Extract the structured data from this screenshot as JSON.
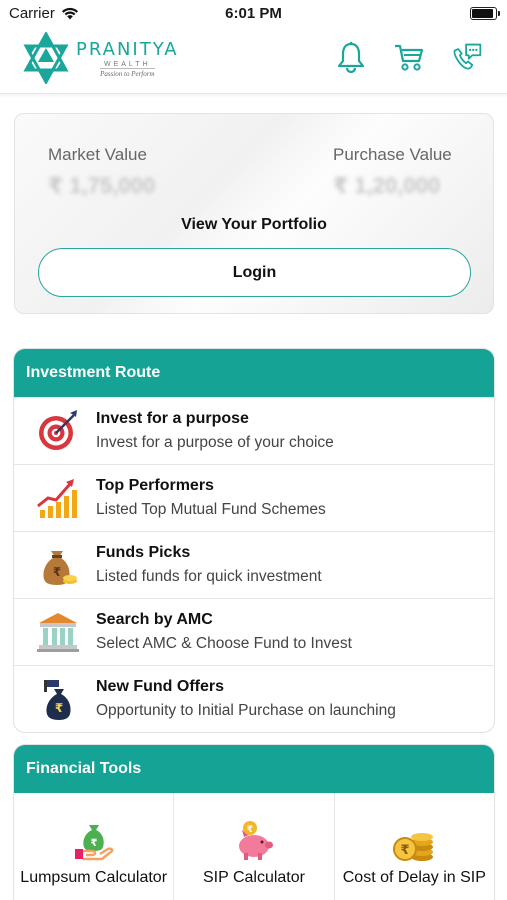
{
  "status": {
    "carrier": "Carrier",
    "time": "6:01 PM",
    "battery_level": 0.9
  },
  "header": {
    "brand": "PRANITYA",
    "brand_sub": "WEALTH",
    "tagline": "Passion to Perform",
    "icons": [
      "bell-icon",
      "cart-icon",
      "chat-phone-icon"
    ],
    "accent": "#14a394"
  },
  "portfolio": {
    "market_label": "Market Value",
    "market_value": "₹ 1,75,000",
    "purchase_label": "Purchase Value",
    "purchase_value": "₹ 1,20,000",
    "title": "View Your Portfolio",
    "login_label": "Login"
  },
  "investment_route": {
    "title": "Investment Route",
    "items": [
      {
        "title": "Invest for a purpose",
        "desc": "Invest for a purpose of your choice",
        "icon": "target-icon"
      },
      {
        "title": "Top Performers",
        "desc": "Listed Top Mutual Fund Schemes",
        "icon": "growth-chart-icon"
      },
      {
        "title": "Funds Picks",
        "desc": "Listed funds for quick investment",
        "icon": "money-bag-icon"
      },
      {
        "title": "Search by AMC",
        "desc": "Select AMC & Choose Fund to Invest",
        "icon": "bank-icon"
      },
      {
        "title": "New Fund Offers",
        "desc": "Opportunity to Initial Purchase on launching",
        "icon": "nfo-bag-icon"
      }
    ]
  },
  "financial_tools": {
    "title": "Financial Tools",
    "items": [
      {
        "label": "Lumpsum Calculator",
        "icon": "lumpsum-icon"
      },
      {
        "label": "SIP Calculator",
        "icon": "piggy-bank-icon"
      },
      {
        "label": "Cost of Delay in SIP",
        "icon": "coin-stack-icon"
      }
    ]
  }
}
